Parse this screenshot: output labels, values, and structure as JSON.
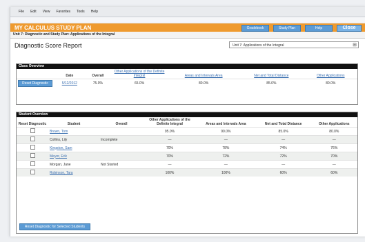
{
  "menubar": [
    "File",
    "Edit",
    "View",
    "Favorites",
    "Tools",
    "Help"
  ],
  "window_title": "MY CALCULUS STUDY PLAN",
  "title_buttons": [
    "Gradebook",
    "Study Plan",
    "Help"
  ],
  "close_label": "Close",
  "breadcrumb": "Unit 7: Diagnostic and Study Plan: Applications of the Integral",
  "report_title": "Diagnostic Score Report",
  "unit_select": "Unit 7: Applications of the Integral",
  "class_overview": {
    "header": "Class Overview",
    "button": "Reset Diagnostic",
    "columns": [
      "Date",
      "Overall",
      "Other Applications of the Definite Integral",
      "Areas and Intervals Area",
      "Net and Total Distance",
      "Other Applications"
    ],
    "row": [
      "5/12/2012",
      "75.0%",
      "65.0%",
      "80.0%",
      "85.0%",
      "80.0%"
    ]
  },
  "student_overview": {
    "header": "Student Overview",
    "columns": [
      "Reset Diagnostic",
      "Student",
      "Overall",
      "Other Applications of the Definite Integral",
      "Areas and Intervals Area",
      "Net and Total Distance",
      "Other Applications"
    ],
    "rows": [
      {
        "student": "Brown, Tom",
        "overall": "",
        "v1": "95.0%",
        "v2": "90.0%",
        "v3": "85.0%",
        "v4": "80.0%",
        "link": true
      },
      {
        "student": "Collins, Lily",
        "overall": "Incomplete",
        "v1": "—",
        "v2": "—",
        "v3": "—",
        "v4": "—",
        "link": false
      },
      {
        "student": "Kingston, Sam",
        "overall": "",
        "v1": "70%",
        "v2": "78%",
        "v3": "74%",
        "v4": "76%",
        "link": true
      },
      {
        "student": "Meyer, Erik",
        "overall": "",
        "v1": "70%",
        "v2": "72%",
        "v3": "72%",
        "v4": "70%",
        "link": true
      },
      {
        "student": "Morgan, Jane",
        "overall": "Not Started",
        "v1": "—",
        "v2": "—",
        "v3": "—",
        "v4": "—",
        "link": false
      },
      {
        "student": "Robinson, Tara",
        "overall": "",
        "v1": "100%",
        "v2": "100%",
        "v3": "60%",
        "v4": "60%",
        "link": true
      }
    ],
    "button": "Reset Diagnostic for Selected Students"
  }
}
